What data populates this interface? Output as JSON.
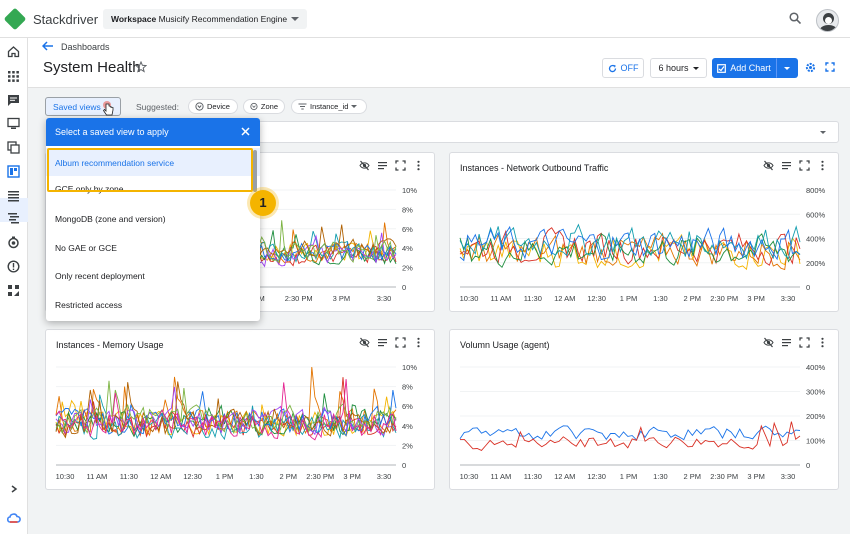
{
  "app": {
    "name": "Stackdriver",
    "workspace_label": "Workspace",
    "workspace_name": "Musicify Recommendation Engine"
  },
  "header": {
    "breadcrumb": "Dashboards",
    "title": "System Health",
    "auto_refresh": "OFF",
    "time_range": "6 hours",
    "add_chart": "Add Chart"
  },
  "filters": {
    "saved_views": "Saved views",
    "suggested": "Suggested:",
    "chips": [
      "Device",
      "Zone",
      "Instance_id"
    ]
  },
  "saved_views_panel": {
    "title": "Select a saved view to apply",
    "items": [
      "Album recommendation service",
      "GCE only by zone",
      "MongoDB (zone and version)",
      "No GAE or GCE",
      "Only recent deployment",
      "Restricted access"
    ]
  },
  "step_badge": "1",
  "colors": {
    "accent": "#1a73e8",
    "highlight": "#f4b400",
    "logo": "#34a853"
  },
  "chart_data": [
    {
      "type": "line",
      "title": "",
      "x_ticks": [
        "2 PM",
        "2:30 PM",
        "3 PM",
        "3:30"
      ],
      "y_ticks": [
        "10%",
        "8%",
        "6%",
        "4%",
        "2%",
        "0"
      ],
      "ylim": [
        0,
        10
      ]
    },
    {
      "type": "line",
      "title": "Instances - Network Outbound Traffic",
      "x_ticks": [
        "10:30",
        "11 AM",
        "11:30",
        "12 AM",
        "12:30",
        "1 PM",
        "1:30",
        "2 PM",
        "2:30 PM",
        "3 PM",
        "3:30"
      ],
      "y_ticks": [
        "800%",
        "600%",
        "400%",
        "200%",
        "0"
      ],
      "ylim": [
        0,
        800
      ]
    },
    {
      "type": "line",
      "title": "Instances - Memory Usage",
      "x_ticks": [
        "10:30",
        "11 AM",
        "11:30",
        "12 AM",
        "12:30",
        "1 PM",
        "1:30",
        "2 PM",
        "2:30 PM",
        "3 PM",
        "3:30"
      ],
      "y_ticks": [
        "10%",
        "8%",
        "6%",
        "4%",
        "2%",
        "0"
      ],
      "ylim": [
        0,
        10
      ]
    },
    {
      "type": "line",
      "title": "Volumn Usage (agent)",
      "x_ticks": [
        "10:30",
        "11 AM",
        "11:30",
        "12 AM",
        "12:30",
        "1 PM",
        "1:30",
        "2 PM",
        "2:30 PM",
        "3 PM",
        "3:30"
      ],
      "y_ticks": [
        "400%",
        "300%",
        "200%",
        "100%",
        "0"
      ],
      "ylim": [
        0,
        400
      ]
    }
  ]
}
